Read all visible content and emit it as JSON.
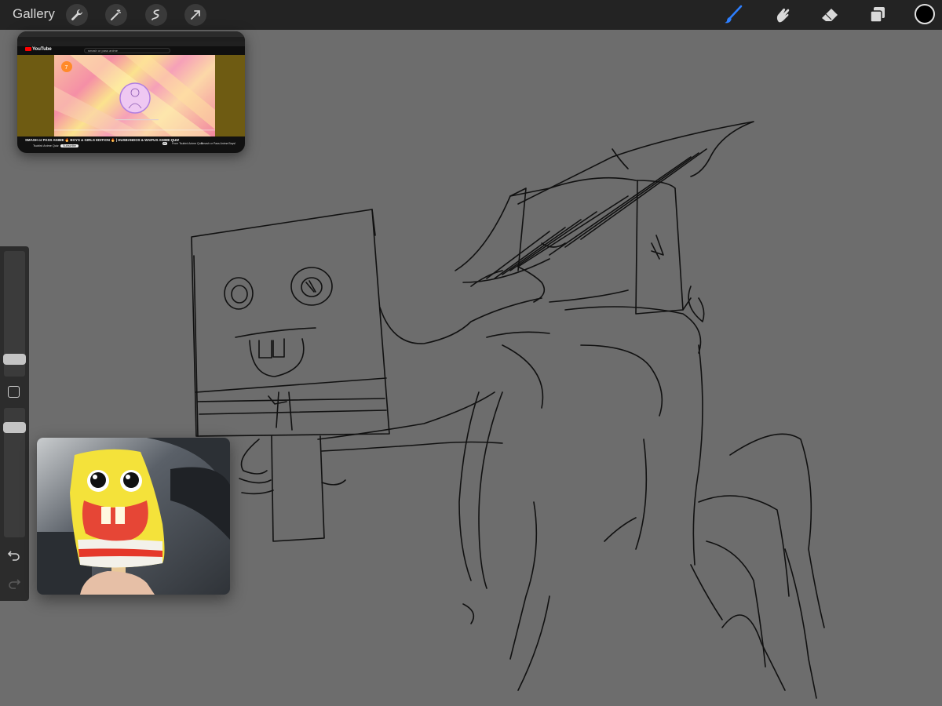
{
  "toolbar": {
    "gallery_label": "Gallery",
    "left_tools": [
      "wrench-icon",
      "magic-wand-icon",
      "selection-icon",
      "transform-arrow-icon"
    ],
    "right_tools": [
      "brush-icon",
      "smudge-icon",
      "eraser-icon",
      "layers-icon"
    ],
    "active_tool": "brush-icon",
    "accent_color": "#2d7fff",
    "current_color": "#000000"
  },
  "sidebar": {
    "brush_size_level": 0.35,
    "opacity_level": 0.35,
    "icons": [
      "modifier-square-icon",
      "undo-icon",
      "redo-icon"
    ]
  },
  "reference_youtube": {
    "logo": "YouTube",
    "search_text": "smash or pass anime",
    "video_title": "SMASH or PASS ANIME 🔥 BOYS & GIRLS EDITION 🔥 | HUSBANDOS & WAIFUS ANIME QUIZ",
    "channel": "Tsubird Anime Quiz",
    "subscribe_label": "Subscribe",
    "chips": [
      "All",
      "From Tsubird Anime Quiz",
      "Smash or Pass Anime Boys!"
    ],
    "time": "0:08 / 12:17"
  },
  "reference_photo": {
    "subject": "spongebob-popsicle"
  },
  "canvas": {
    "background": "#6d6d6d",
    "stroke_color": "#111111"
  }
}
